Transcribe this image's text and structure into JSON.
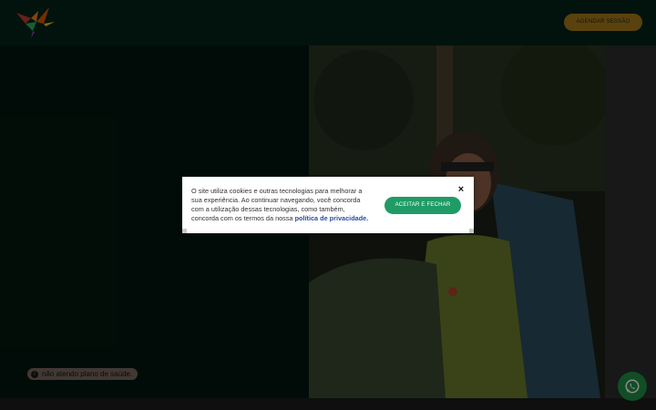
{
  "header": {
    "cta_label": "AGENDAR SESSÃO"
  },
  "notice": {
    "icon": "info-icon",
    "icon_glyph": "i",
    "text": "não atendo plano de saúde."
  },
  "cookie_banner": {
    "message": "O site utiliza cookies e outras tecnologias para melhorar a sua experiência. Ao continuar navegando, você concorda com a utilização dessas tecnologias, como também, concorda com os termos da nossa ",
    "link_text": "política de privacidade.",
    "accept_label": "ACEITAR E FECHAR",
    "close_glyph": "×"
  },
  "colors": {
    "accent": "#d8961c",
    "accept": "#1f9b66",
    "whatsapp": "#1f8f46",
    "link": "#2b4f9e"
  }
}
